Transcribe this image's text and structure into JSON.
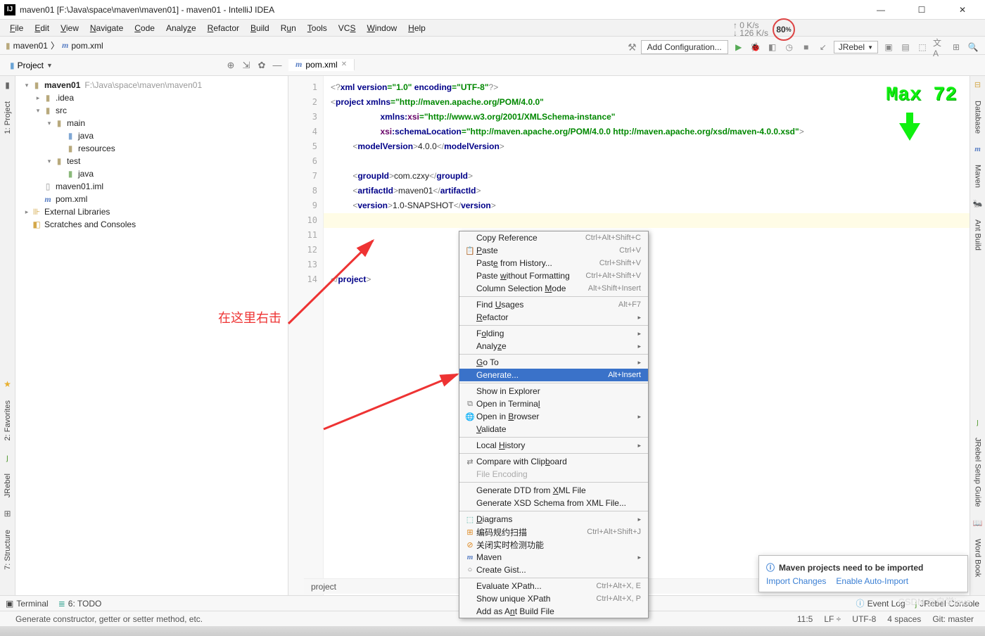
{
  "title": "maven01 [F:\\Java\\space\\maven\\maven01] - maven01 - IntelliJ IDEA",
  "menu": [
    "File",
    "Edit",
    "View",
    "Navigate",
    "Code",
    "Analyze",
    "Refactor",
    "Build",
    "Run",
    "Tools",
    "VCS",
    "Window",
    "Help"
  ],
  "crumb": {
    "proj": "maven01",
    "file": "pom.xml"
  },
  "projtool": {
    "label": "Project"
  },
  "tree": {
    "root": {
      "name": "maven01",
      "path": "F:\\Java\\space\\maven\\maven01"
    },
    "idea": ".idea",
    "src": "src",
    "main": "main",
    "java1": "java",
    "resources": "resources",
    "test": "test",
    "java2": "java",
    "iml": "maven01.iml",
    "pom": "pom.xml",
    "ext": "External Libraries",
    "scr": "Scratches and Consoles"
  },
  "tab": {
    "name": "pom.xml"
  },
  "addcfg": "Add Configuration...",
  "jrebel": "JRebel",
  "perf": {
    "up": "↑ 0  K/s",
    "down": "↓ 126 K/s",
    "pct": "80",
    "pctu": "%"
  },
  "overlay_max": "Max  72",
  "code": {
    "l1_a": "<?",
    "l1_b": "xml version",
    "l1_c": "=\"1.0\" ",
    "l1_d": "encoding",
    "l1_e": "=\"UTF-8\"",
    "l1_f": "?>",
    "l2_a": "<",
    "l2_b": "project ",
    "l2_c": "xmlns",
    "l2_d": "=\"http://maven.apache.org/POM/4.0.0\"",
    "l3_a": "xmlns:",
    "l3_b": "xsi",
    "l3_c": "=\"http://www.w3.org/2001/XMLSchema-instance\"",
    "l4_a": "xsi",
    "l4_b": ":schemaLocation",
    "l4_c": "=\"http://maven.apache.org/POM/4.0.0 http://maven.apache.org/xsd/maven-4.0.0.xsd\"",
    "l4_d": ">",
    "l5_a": "<",
    "l5_b": "modelVersion",
    "l5_c": ">",
    "l5_d": "4.0.0",
    "l5_e": "</",
    "l5_f": "modelVersion",
    "l5_g": ">",
    "l7_a": "<",
    "l7_b": "groupId",
    "l7_c": ">",
    "l7_d": "com.czxy",
    "l7_e": "</",
    "l7_f": "groupId",
    "l7_g": ">",
    "l8_a": "<",
    "l8_b": "artifactId",
    "l8_c": ">",
    "l8_d": "maven01",
    "l8_e": "</",
    "l8_f": "artifactId",
    "l8_g": ">",
    "l9_a": "<",
    "l9_b": "version",
    "l9_c": ">",
    "l9_d": "1.0-SNAPSHOT",
    "l9_e": "</",
    "l9_f": "version",
    "l9_g": ">",
    "l14_a": "</",
    "l14_b": "project",
    "l14_c": ">"
  },
  "annotation": "在这里右击",
  "ctx": {
    "copyref": {
      "l": "Copy Reference",
      "s": "Ctrl+Alt+Shift+C"
    },
    "paste": {
      "l": "Paste",
      "s": "Ctrl+V"
    },
    "pasteh": {
      "l": "Paste from History...",
      "s": "Ctrl+Shift+V"
    },
    "pastew": {
      "l": "Paste without Formatting",
      "s": "Ctrl+Alt+Shift+V"
    },
    "colsel": {
      "l": "Column Selection Mode",
      "s": "Alt+Shift+Insert"
    },
    "findu": {
      "l": "Find Usages",
      "s": "Alt+F7"
    },
    "refactor": {
      "l": "Refactor"
    },
    "folding": {
      "l": "Folding"
    },
    "analyze": {
      "l": "Analyze"
    },
    "goto": {
      "l": "Go To"
    },
    "generate": {
      "l": "Generate...",
      "s": "Alt+Insert"
    },
    "showexp": {
      "l": "Show in Explorer"
    },
    "openterm": {
      "l": "Open in Terminal"
    },
    "openbrow": {
      "l": "Open in Browser"
    },
    "validate": {
      "l": "Validate"
    },
    "lochist": {
      "l": "Local History"
    },
    "compclip": {
      "l": "Compare with Clipboard"
    },
    "fileenc": {
      "l": "File Encoding"
    },
    "gendtd": {
      "l": "Generate DTD from XML File"
    },
    "genxsd": {
      "l": "Generate XSD Schema from XML File..."
    },
    "diagrams": {
      "l": "Diagrams"
    },
    "scanrules": {
      "l": "编码规约扫描",
      "s": "Ctrl+Alt+Shift+J"
    },
    "closert": {
      "l": "关闭实时检测功能"
    },
    "maven": {
      "l": "Maven"
    },
    "gist": {
      "l": "Create Gist..."
    },
    "evalxp": {
      "l": "Evaluate XPath...",
      "s": "Ctrl+Alt+X, E"
    },
    "showxp": {
      "l": "Show unique XPath",
      "s": "Ctrl+Alt+X, P"
    },
    "addant": {
      "l": "Add as Ant Build File"
    }
  },
  "notif": {
    "title": "Maven projects need to be imported",
    "link1": "Import Changes",
    "link2": "Enable Auto-Import"
  },
  "footcrumb": "project",
  "bottom": {
    "terminal": "Terminal",
    "todo": "6: TODO",
    "eventlog": "Event Log",
    "jrconsole": "JRebel Console"
  },
  "status": {
    "tip": "Generate constructor, getter or setter method, etc.",
    "pos": "11:5",
    "le": "LF ÷",
    "enc": "UTF-8",
    "sp": "4 spaces",
    "git": "Git: master",
    "wm": "CSDN @自学java"
  },
  "left": {
    "project": "1: Project",
    "fav": "2: Favorites",
    "struct": "7: Structure",
    "jrebel": "JRebel"
  },
  "right": {
    "db": "Database",
    "maven": "Maven",
    "ant": "Ant Build",
    "jrsetup": "JRebel Setup Guide",
    "wb": "Word Book"
  }
}
